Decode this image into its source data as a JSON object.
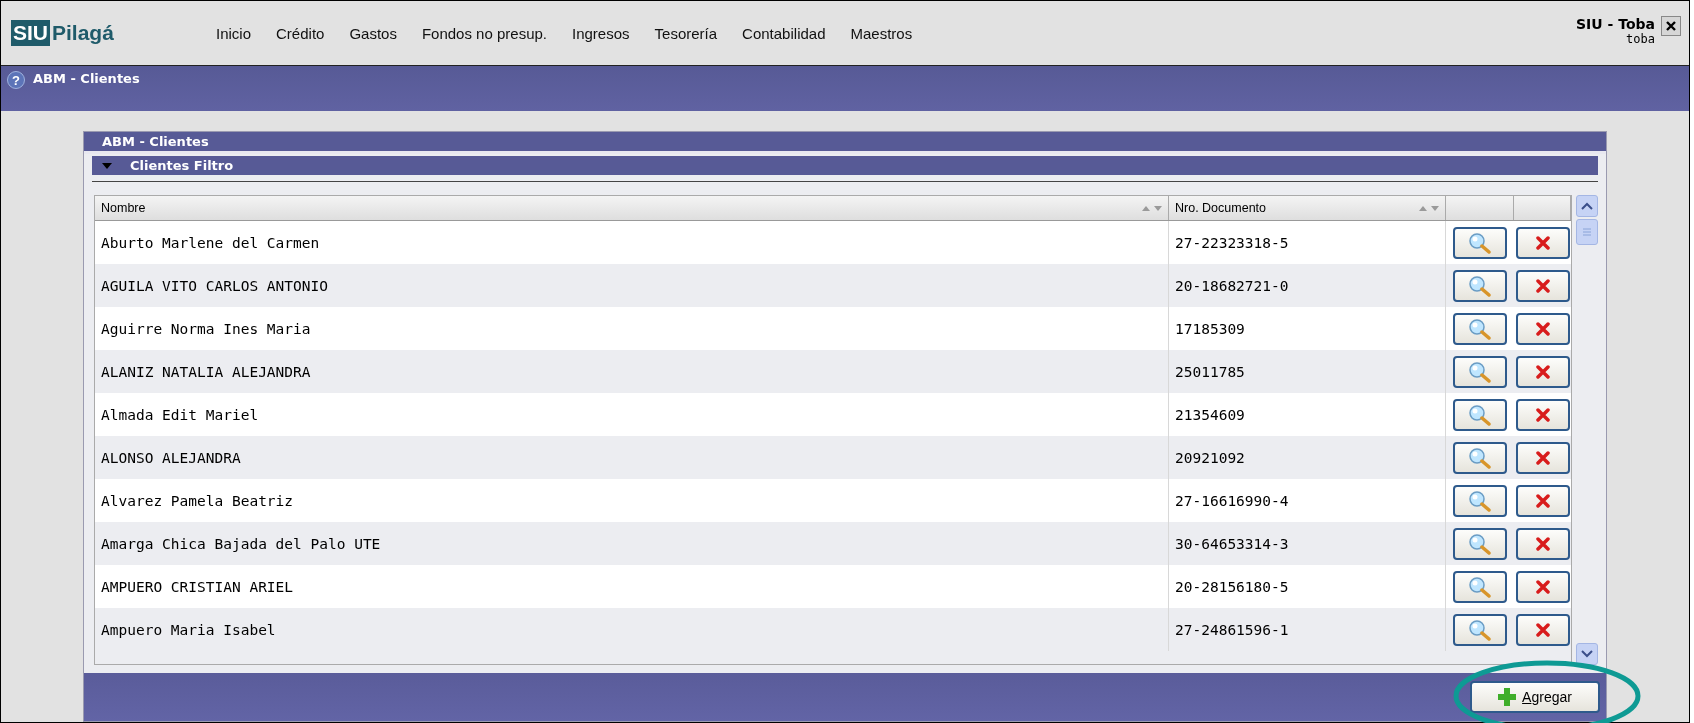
{
  "app": {
    "logo_mark": "SIU",
    "logo_name": "Pilagá",
    "system": "SIU - Toba",
    "user": "toba"
  },
  "menu": [
    {
      "label": "Inicio"
    },
    {
      "label": "Crédito"
    },
    {
      "label": "Gastos"
    },
    {
      "label": "Fondos no presup."
    },
    {
      "label": "Ingresos"
    },
    {
      "label": "Tesorería"
    },
    {
      "label": "Contabilidad"
    },
    {
      "label": "Maestros"
    }
  ],
  "help": "?",
  "page_title": "ABM - Clientes",
  "panel": {
    "title": "ABM - Clientes",
    "filter": {
      "title": "Clientes Filtro",
      "expanded": true
    }
  },
  "table": {
    "columns": [
      {
        "label": "Nombre",
        "sortable": true
      },
      {
        "label": "Nro. Documento",
        "sortable": true
      },
      {},
      {}
    ],
    "rows": [
      {
        "nombre": "Aburto Marlene del Carmen",
        "documento": "27-22323318-5"
      },
      {
        "nombre": "AGUILA VITO CARLOS ANTONIO",
        "documento": "20-18682721-0"
      },
      {
        "nombre": "Aguirre Norma Ines Maria",
        "documento": "17185309"
      },
      {
        "nombre": "ALANIZ NATALIA ALEJANDRA",
        "documento": "25011785"
      },
      {
        "nombre": "Almada Edit Mariel",
        "documento": "21354609"
      },
      {
        "nombre": "ALONSO ALEJANDRA",
        "documento": "20921092"
      },
      {
        "nombre": "Alvarez Pamela Beatriz",
        "documento": "27-16616990-4"
      },
      {
        "nombre": "Amarga Chica Bajada del Palo UTE",
        "documento": "30-64653314-3"
      },
      {
        "nombre": "AMPUERO CRISTIAN ARIEL",
        "documento": "20-28156180-5"
      },
      {
        "nombre": "Ampuero Maria Isabel",
        "documento": "27-24861596-1"
      }
    ]
  },
  "footer": {
    "add_button": "Agregar",
    "highlighted": true
  }
}
